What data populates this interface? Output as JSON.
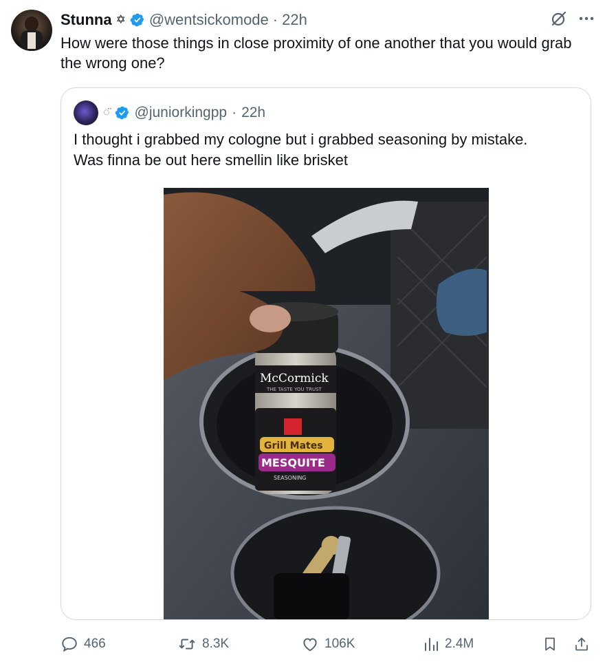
{
  "tweet": {
    "author_name": "Stunna",
    "author_handle": "@wentsickomode",
    "time": "22h",
    "text": "How were those things in close proximity of one another that you would grab the wrong one?"
  },
  "quoted": {
    "author_handle": "@juniorkingpp",
    "time": "22h",
    "text_line1": "I thought i grabbed my cologne but i grabbed seasoning by mistake.",
    "text_line2": "Was finna be out here smellin like brisket",
    "photo": {
      "brand": "McCormick",
      "tagline": "THE TASTE YOU TRUST",
      "line": "Grill Mates",
      "flavor": "MESQUITE",
      "kind": "SEASONING"
    }
  },
  "actions": {
    "replies": "466",
    "reposts": "8.3K",
    "likes": "106K",
    "views": "2.4M"
  },
  "colors": {
    "verified": "#1d9bf0",
    "secondary_text": "#536471",
    "border": "#cfd9de"
  },
  "icons": [
    "verified-badge-icon",
    "grok-icon",
    "more-icon",
    "reply-icon",
    "repost-icon",
    "like-icon",
    "views-icon",
    "bookmark-icon",
    "share-icon"
  ]
}
